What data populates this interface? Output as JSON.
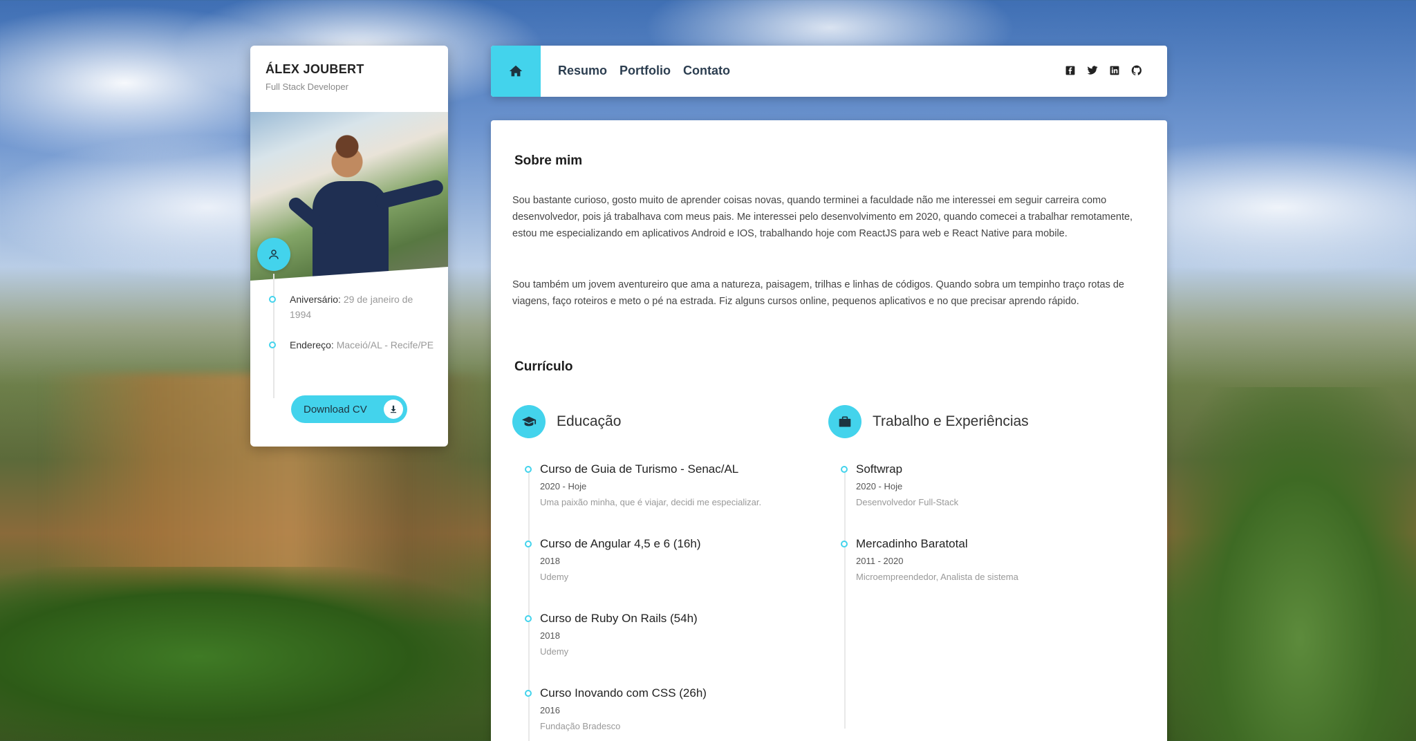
{
  "profile": {
    "name": "ÁLEX JOUBERT",
    "role": "Full Stack Developer",
    "info": [
      {
        "label": "Aniversário:",
        "value": "29 de janeiro de 1994"
      },
      {
        "label": "Endereço:",
        "value": "Maceió/AL - Recife/PE"
      }
    ],
    "download_label": "Download CV"
  },
  "nav": {
    "links": [
      "Resumo",
      "Portfolio",
      "Contato"
    ],
    "socials": [
      "facebook-icon",
      "twitter-icon",
      "linkedin-icon",
      "github-icon"
    ]
  },
  "about": {
    "title": "Sobre mim",
    "paragraphs": [
      "Sou bastante curioso, gosto muito de aprender coisas novas, quando terminei a faculdade não me interessei em seguir carreira como desenvolvedor, pois já trabalhava com meus pais. Me interessei pelo desenvolvimento em 2020, quando comecei a trabalhar remotamente, estou me especializando em aplicativos Android e IOS, trabalhando hoje com ReactJS para web e React Native para mobile.",
      "Sou também um jovem aventureiro que ama a natureza, paisagem, trilhas e linhas de códigos. Quando sobra um tempinho traço rotas de viagens, faço roteiros e meto o pé na estrada. Fiz alguns cursos online, pequenos aplicativos e no que precisar aprendo rápido."
    ]
  },
  "resume": {
    "title": "Currículo",
    "education": {
      "title": "Educação",
      "items": [
        {
          "title": "Curso de Guia de Turismo - Senac/AL",
          "date": "2020 - Hoje",
          "desc": "Uma paixão minha, que é viajar, decidi me especializar."
        },
        {
          "title": "Curso de Angular 4,5 e 6 (16h)",
          "date": "2018",
          "desc": "Udemy"
        },
        {
          "title": "Curso de Ruby On Rails (54h)",
          "date": "2018",
          "desc": "Udemy"
        },
        {
          "title": "Curso Inovando com CSS (26h)",
          "date": "2016",
          "desc": "Fundação Bradesco"
        }
      ]
    },
    "work": {
      "title": "Trabalho e Experiências",
      "items": [
        {
          "title": "Softwrap",
          "date": "2020 - Hoje",
          "desc": "Desenvolvedor Full-Stack"
        },
        {
          "title": "Mercadinho Baratotal",
          "date": "2011 - 2020",
          "desc": "Microempreendedor, Analista de sistema"
        }
      ]
    }
  },
  "colors": {
    "accent": "#43d3ec"
  }
}
